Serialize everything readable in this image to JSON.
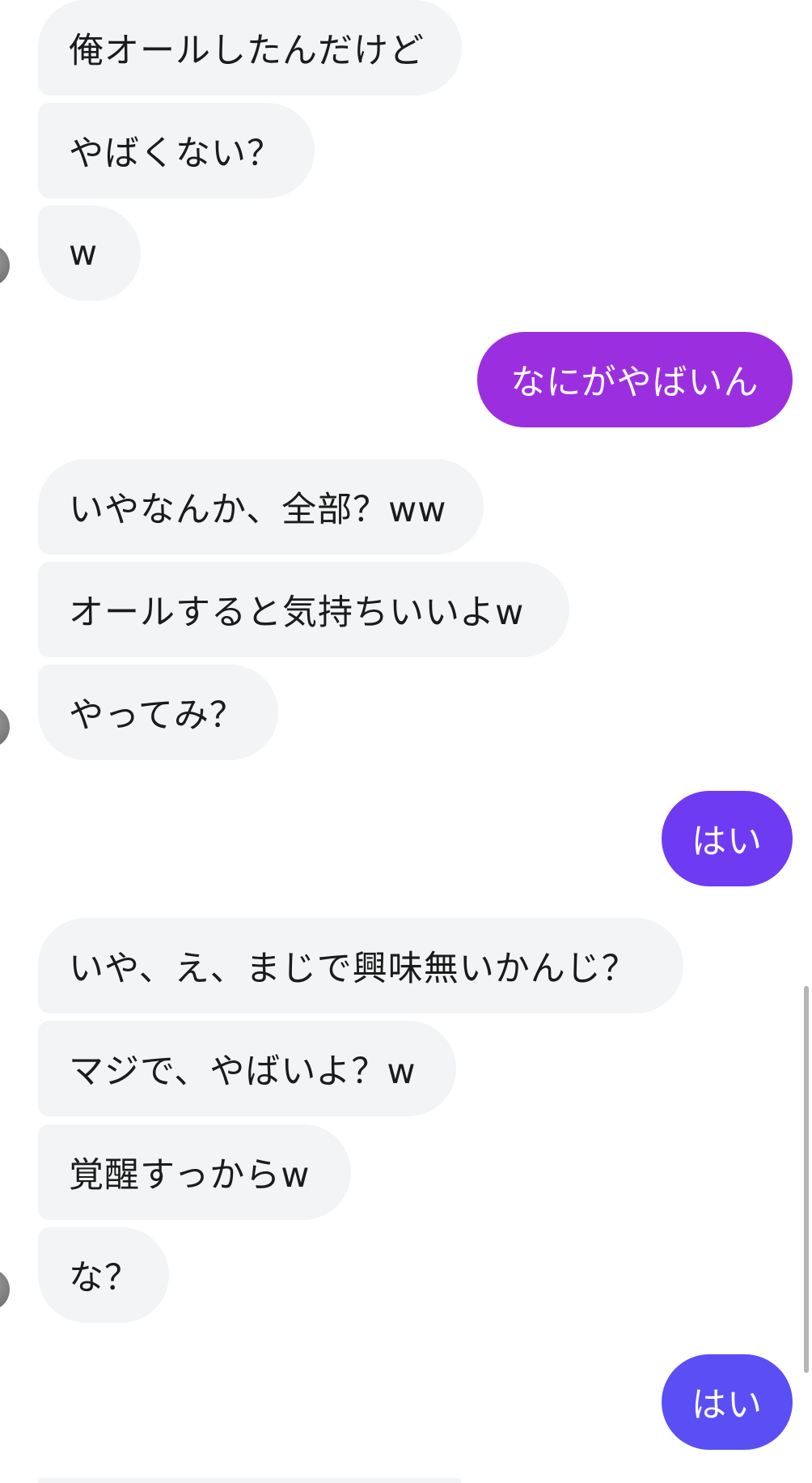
{
  "conversation": {
    "messages": [
      {
        "side": "incoming",
        "text": "俺オールしたんだけど"
      },
      {
        "side": "incoming",
        "text": "やばくない？"
      },
      {
        "side": "incoming",
        "text": "w"
      },
      {
        "side": "outgoing",
        "text": "なにがやばいん"
      },
      {
        "side": "incoming",
        "text": "いやなんか、全部？ww"
      },
      {
        "side": "incoming",
        "text": "オールすると気持ちいいよw"
      },
      {
        "side": "incoming",
        "text": "やってみ？"
      },
      {
        "side": "outgoing",
        "text": "はい"
      },
      {
        "side": "incoming",
        "text": "いや、え、まじで興味無いかんじ？"
      },
      {
        "side": "incoming",
        "text": "マジで、やばいよ？w"
      },
      {
        "side": "incoming",
        "text": "覚醒すっからw"
      },
      {
        "side": "incoming",
        "text": "な？"
      },
      {
        "side": "outgoing",
        "text": "はい"
      }
    ]
  },
  "theme": {
    "incoming_bubble_color": "#f2f4f5",
    "outgoing_gradient_top": "#9b2fe0",
    "outgoing_gradient_mid": "#6f3bf2",
    "outgoing_gradient_bottom": "#5a4ff5"
  }
}
